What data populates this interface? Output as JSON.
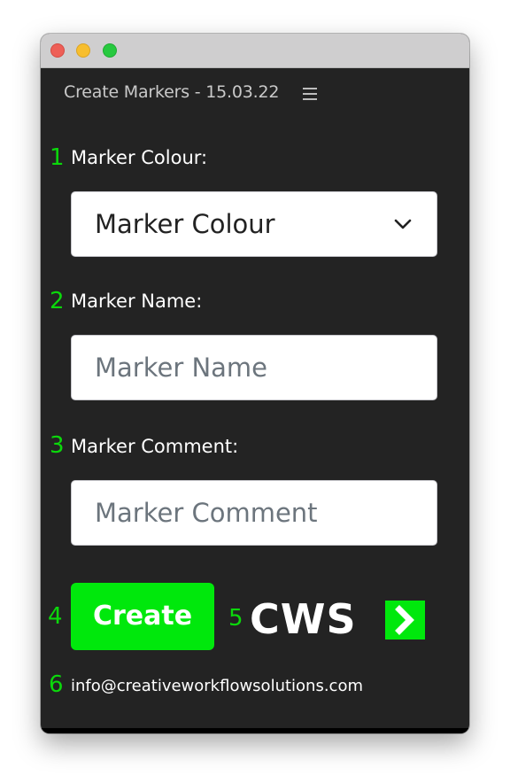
{
  "window": {
    "controls": [
      "close",
      "minimize",
      "maximize"
    ]
  },
  "panel": {
    "title": "Create Markers - 15.03.22",
    "menu_icon": "hamburger-menu-icon"
  },
  "steps": {
    "s1": "1",
    "s2": "2",
    "s3": "3",
    "s4": "4",
    "s5": "5",
    "s6": "6"
  },
  "colour_field": {
    "label": "Marker Colour:",
    "selected": "Marker Colour"
  },
  "name_field": {
    "label": "Marker Name:",
    "placeholder": "Marker Name"
  },
  "comment_field": {
    "label": "Marker Comment:",
    "placeholder": "Marker Comment"
  },
  "actions": {
    "create_label": "Create"
  },
  "logo": {
    "text": "CWS",
    "icon": "chevron-right-icon"
  },
  "contact": {
    "email": "info@creativeworkflowsolutions.com"
  },
  "colors": {
    "accent": "#00e80c",
    "step_number": "#0bd80b",
    "panel_bg": "#232323",
    "titlebar": "#cfcecf"
  }
}
